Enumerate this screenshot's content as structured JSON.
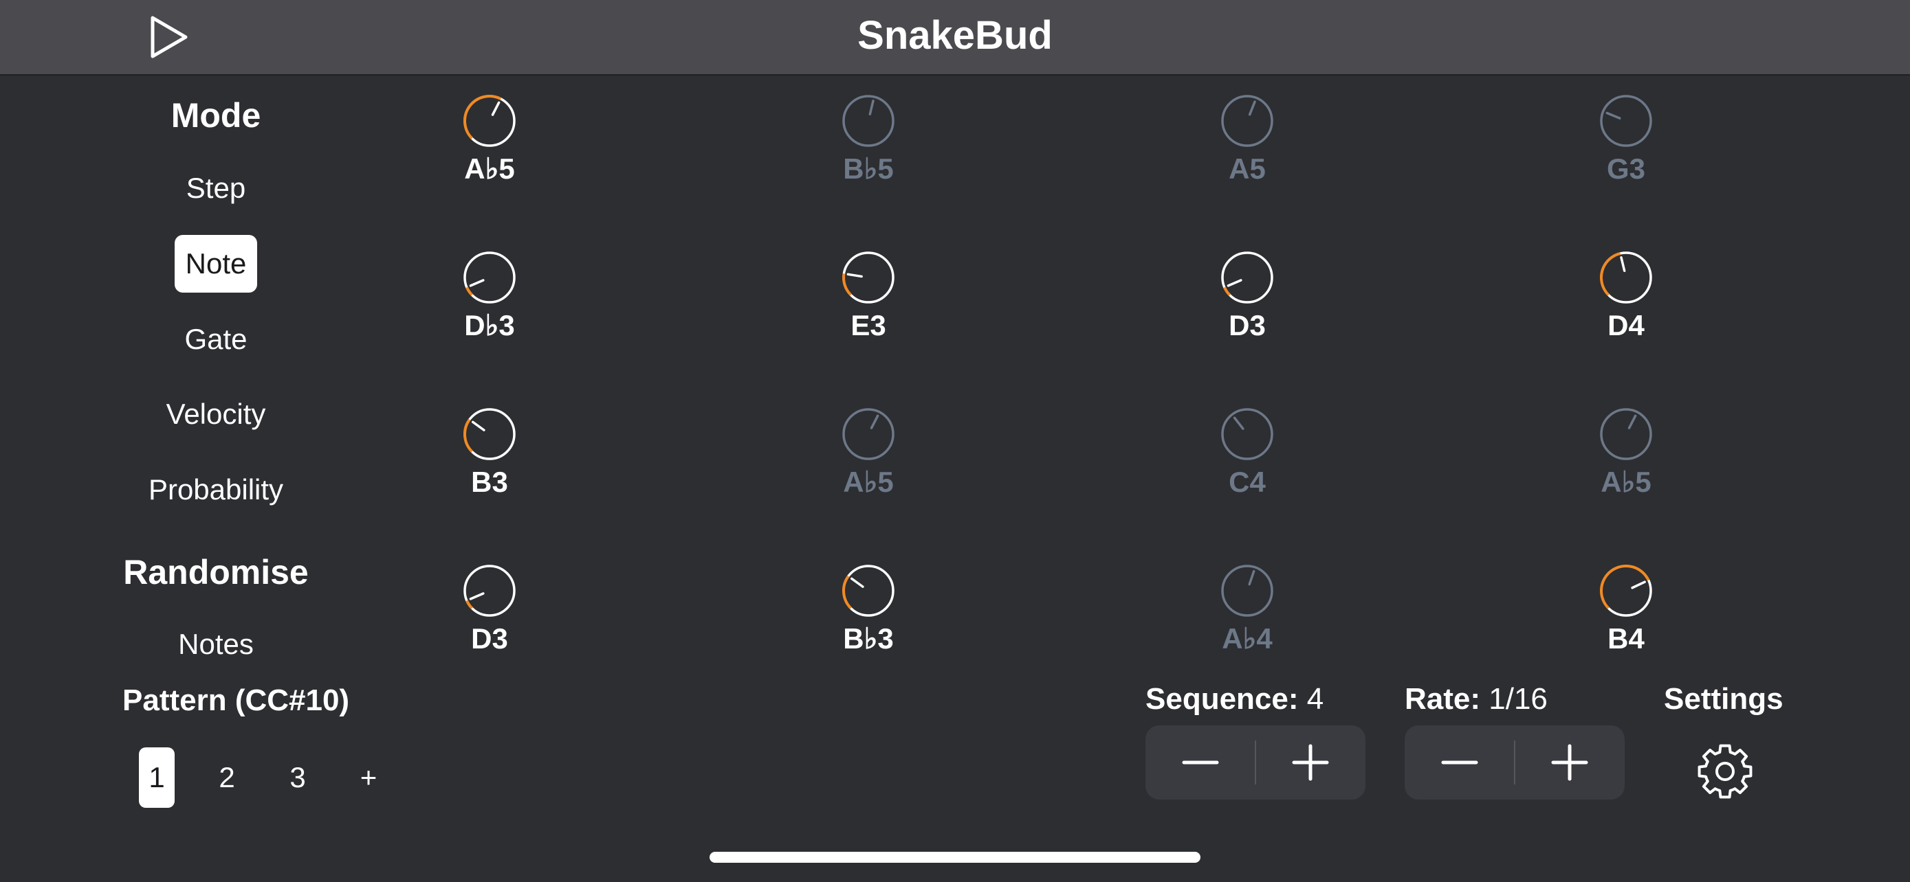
{
  "header": {
    "title": "SnakeBud",
    "play_icon": "play-icon"
  },
  "sidebar": {
    "mode_heading": "Mode",
    "modes": [
      {
        "label": "Step",
        "selected": false
      },
      {
        "label": "Note",
        "selected": true
      },
      {
        "label": "Gate",
        "selected": false
      },
      {
        "label": "Velocity",
        "selected": false
      },
      {
        "label": "Probability",
        "selected": false
      }
    ],
    "randomise_heading": "Randomise",
    "randomise_items": [
      {
        "label": "Notes"
      }
    ],
    "pattern_heading": "Pattern (CC#10)",
    "patterns": [
      {
        "label": "1",
        "selected": true
      },
      {
        "label": "2",
        "selected": false
      },
      {
        "label": "3",
        "selected": false
      },
      {
        "label": "+",
        "selected": false
      }
    ]
  },
  "steps": [
    {
      "note": "A♭5",
      "active": true,
      "value": 0.6
    },
    {
      "note": "B♭5",
      "active": false,
      "value": 0.55
    },
    {
      "note": "A5",
      "active": false,
      "value": 0.58
    },
    {
      "note": "G3",
      "active": false,
      "value": 0.25
    },
    {
      "note": "D♭3",
      "active": true,
      "value": 0.08
    },
    {
      "note": "E3",
      "active": true,
      "value": 0.2
    },
    {
      "note": "D3",
      "active": true,
      "value": 0.08
    },
    {
      "note": "D4",
      "active": true,
      "value": 0.45
    },
    {
      "note": "B3",
      "active": true,
      "value": 0.3
    },
    {
      "note": "A♭5",
      "active": false,
      "value": 0.6
    },
    {
      "note": "C4",
      "active": false,
      "value": 0.36
    },
    {
      "note": "A♭5",
      "active": false,
      "value": 0.6
    },
    {
      "note": "D3",
      "active": true,
      "value": 0.08
    },
    {
      "note": "B♭3",
      "active": true,
      "value": 0.3
    },
    {
      "note": "A♭4",
      "active": false,
      "value": 0.57
    },
    {
      "note": "B4",
      "active": true,
      "value": 0.74
    }
  ],
  "controls": {
    "sequence": {
      "label": "Sequence:",
      "value": "4"
    },
    "rate": {
      "label": "Rate:",
      "value": "1/16"
    },
    "settings": {
      "label": "Settings",
      "icon": "gear-icon"
    }
  },
  "colors": {
    "accent": "#f08a24",
    "knob_active": "#ffffff",
    "knob_inactive": "#6d7888",
    "background": "#2d2e32",
    "header": "#4a4a4f"
  }
}
